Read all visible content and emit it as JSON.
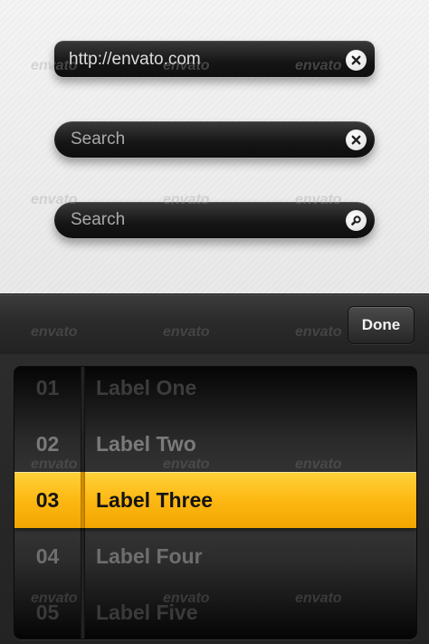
{
  "fields": {
    "url": {
      "value": "http://envato.com",
      "button_icon": "clear-icon"
    },
    "search_clear": {
      "placeholder": "Search",
      "button_icon": "clear-icon"
    },
    "search_go": {
      "placeholder": "Search",
      "button_icon": "search-icon"
    }
  },
  "toolbar": {
    "done_label": "Done"
  },
  "picker": {
    "rows": [
      {
        "number": "01",
        "label": "Label One"
      },
      {
        "number": "02",
        "label": "Label Two"
      },
      {
        "number": "03",
        "label": "Label Three"
      },
      {
        "number": "04",
        "label": "Label Four"
      },
      {
        "number": "05",
        "label": "Label Five"
      }
    ],
    "selected_index": 2
  },
  "watermark": "envato",
  "colors": {
    "accent": "#fdb813",
    "dark": "#1a1a1a",
    "light": "#ececec"
  }
}
